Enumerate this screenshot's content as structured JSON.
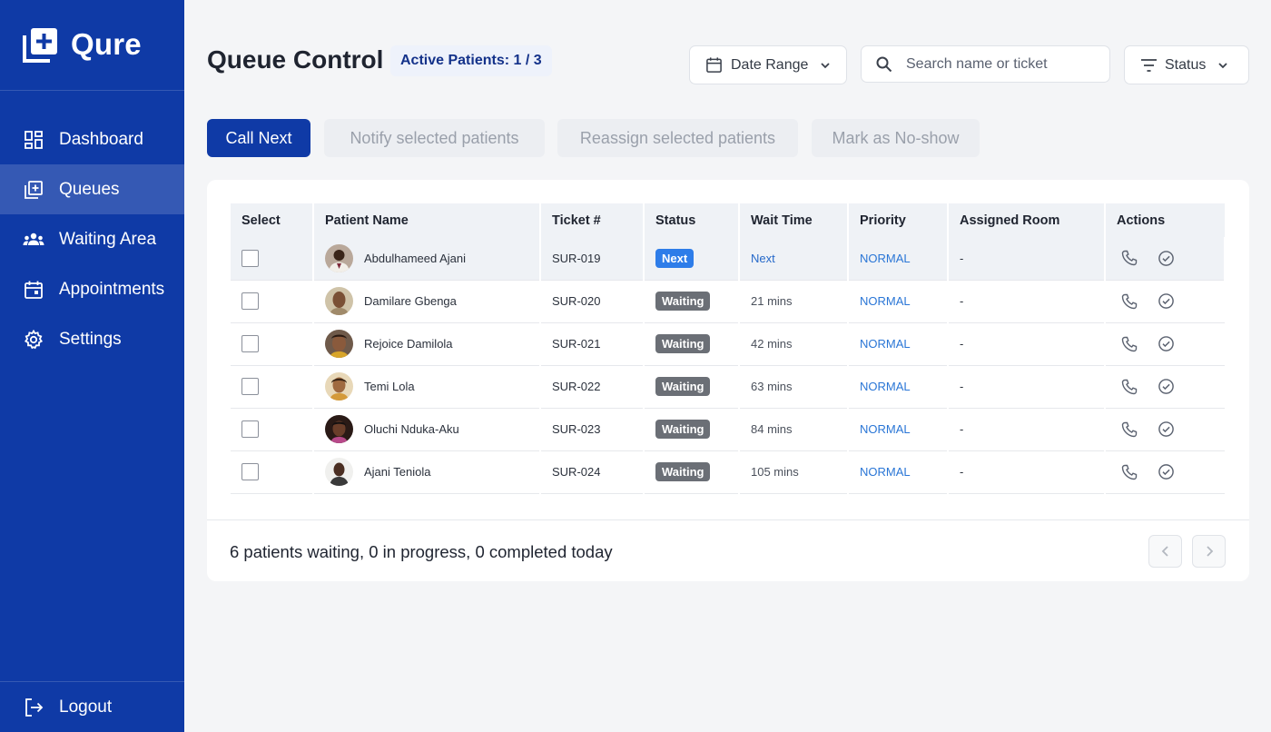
{
  "brand": {
    "name": "Qure",
    "icon": "queue-plus-icon"
  },
  "sidebar": {
    "items": [
      {
        "label": "Dashboard",
        "icon": "dashboard-icon",
        "active": false
      },
      {
        "label": "Queues",
        "icon": "queue-icon",
        "active": true
      },
      {
        "label": "Waiting Area",
        "icon": "people-icon",
        "active": false
      },
      {
        "label": "Appointments",
        "icon": "calendar-icon",
        "active": false
      },
      {
        "label": "Settings",
        "icon": "gear-icon",
        "active": false
      }
    ],
    "logout": {
      "label": "Logout",
      "icon": "logout-icon"
    }
  },
  "header": {
    "title": "Queue Control",
    "active_patients": "Active Patients: 1 / 3",
    "date_range_label": "Date Range",
    "search_placeholder": "Search name or ticket",
    "status_filter_label": "Status"
  },
  "toolbar": {
    "call_next": "Call Next",
    "notify": "Notify selected patients",
    "reassign": "Reassign selected patients",
    "no_show": "Mark as No-show"
  },
  "table": {
    "columns": [
      "Select",
      "Patient Name",
      "Ticket #",
      "Status",
      "Wait Time",
      "Priority",
      "Assigned Room",
      "Actions"
    ],
    "rows": [
      {
        "name": "Abdulhameed Ajani",
        "ticket": "SUR-019",
        "status": "Next",
        "wait": "Next",
        "priority": "NORMAL",
        "room": "-"
      },
      {
        "name": "Damilare Gbenga",
        "ticket": "SUR-020",
        "status": "Waiting",
        "wait": "21 mins",
        "priority": "NORMAL",
        "room": "-"
      },
      {
        "name": "Rejoice Damilola",
        "ticket": "SUR-021",
        "status": "Waiting",
        "wait": "42 mins",
        "priority": "NORMAL",
        "room": "-"
      },
      {
        "name": "Temi Lola",
        "ticket": "SUR-022",
        "status": "Waiting",
        "wait": "63 mins",
        "priority": "NORMAL",
        "room": "-"
      },
      {
        "name": "Oluchi Nduka-Aku",
        "ticket": "SUR-023",
        "status": "Waiting",
        "wait": "84 mins",
        "priority": "NORMAL",
        "room": "-"
      },
      {
        "name": "Ajani Teniola",
        "ticket": "SUR-024",
        "status": "Waiting",
        "wait": "105 mins",
        "priority": "NORMAL",
        "room": "-"
      }
    ]
  },
  "footer": {
    "summary": "6 patients waiting, 0 in progress, 0 completed today"
  },
  "colors": {
    "sidebar": "#0f3aa6",
    "primary": "#0f3aa6",
    "next_badge": "#2e7de9",
    "waiting_badge": "#6b6f76",
    "priority": "#2a76d6"
  }
}
